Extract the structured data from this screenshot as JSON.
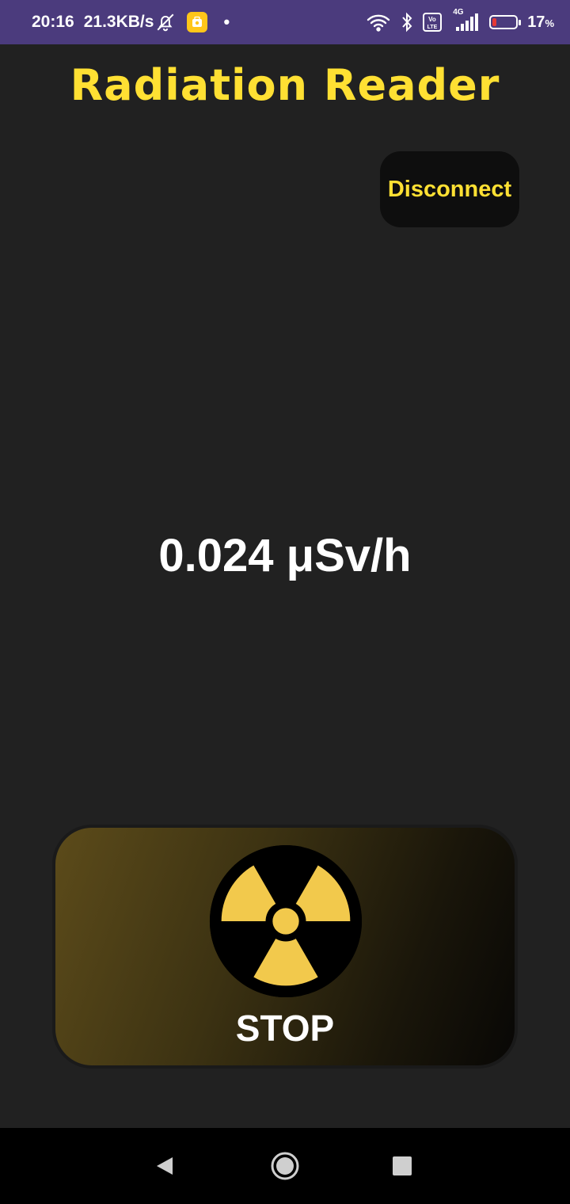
{
  "status_bar": {
    "time": "20:16",
    "network_speed": "21.3KB/s",
    "network_type": "4G",
    "volte": "Vo LTE",
    "battery_percent": "17",
    "battery_unit": "%",
    "battery_level": 0.17,
    "icons": [
      "bell-off-icon",
      "app-notification-icon",
      "wifi-icon",
      "bluetooth-icon",
      "volte-icon",
      "signal-icon",
      "battery-icon"
    ]
  },
  "app": {
    "title": "Radiation Reader",
    "title_color": "#ffe033",
    "background_color": "#212121"
  },
  "disconnect_button": {
    "label": "Disconnect"
  },
  "reading": {
    "value": "0.024 μSv/h"
  },
  "stop_button": {
    "icon": "radiation-icon",
    "label": "STOP"
  },
  "nav_bar": {
    "icons": [
      "back-icon",
      "home-icon",
      "recents-icon"
    ]
  }
}
